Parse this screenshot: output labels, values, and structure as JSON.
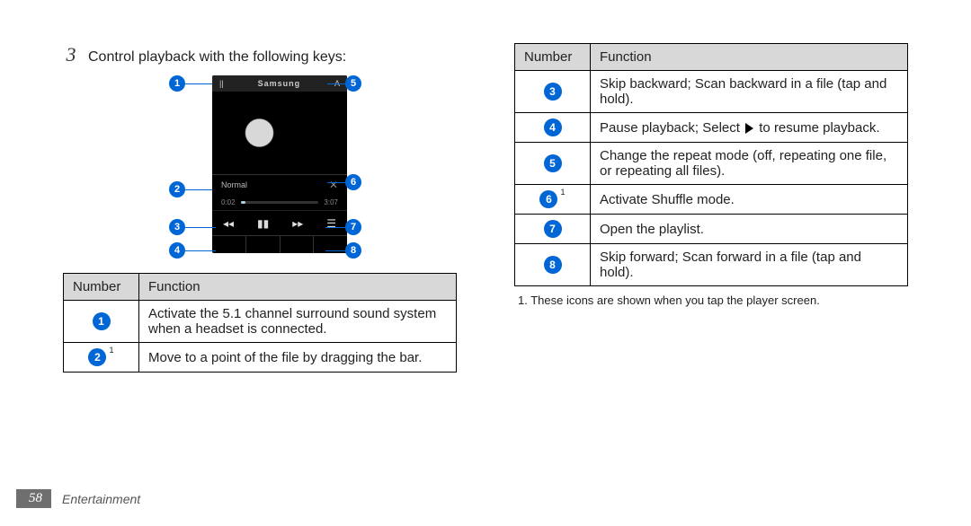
{
  "step": {
    "number": "3",
    "text": "Control playback with the following keys:"
  },
  "phone": {
    "top_left_icon": "||",
    "brand": "Samsung",
    "top_right": "A",
    "eq_label": "Normal",
    "time_left": "0:02",
    "time_right": "3:07"
  },
  "callouts": {
    "1": "1",
    "2": "2",
    "3": "3",
    "4": "4",
    "5": "5",
    "6": "6",
    "7": "7",
    "8": "8"
  },
  "tables": {
    "headers": {
      "number": "Number",
      "function": "Function"
    },
    "left_rows": [
      {
        "n": "1",
        "sup": "",
        "func": "Activate the 5.1 channel surround sound system when a headset is connected."
      },
      {
        "n": "2",
        "sup": "1",
        "func": "Move to a point of the file by dragging the bar."
      }
    ],
    "right_rows": [
      {
        "n": "3",
        "sup": "",
        "pre": "Skip backward; Scan backward in a file (tap and hold).",
        "hasPlay": false,
        "post": ""
      },
      {
        "n": "4",
        "sup": "",
        "pre": "Pause playback; Select ",
        "hasPlay": true,
        "post": " to resume playback."
      },
      {
        "n": "5",
        "sup": "",
        "pre": "Change the repeat mode (off, repeating one file, or repeating all files).",
        "hasPlay": false,
        "post": ""
      },
      {
        "n": "6",
        "sup": "1",
        "pre": "Activate Shuffle mode.",
        "hasPlay": false,
        "post": ""
      },
      {
        "n": "7",
        "sup": "",
        "pre": "Open the playlist.",
        "hasPlay": false,
        "post": ""
      },
      {
        "n": "8",
        "sup": "",
        "pre": "Skip forward; Scan forward in a file (tap and hold).",
        "hasPlay": false,
        "post": ""
      }
    ]
  },
  "footnote": "1.  These icons are shown when you tap the player screen.",
  "footer": {
    "page": "58",
    "section": "Entertainment"
  }
}
